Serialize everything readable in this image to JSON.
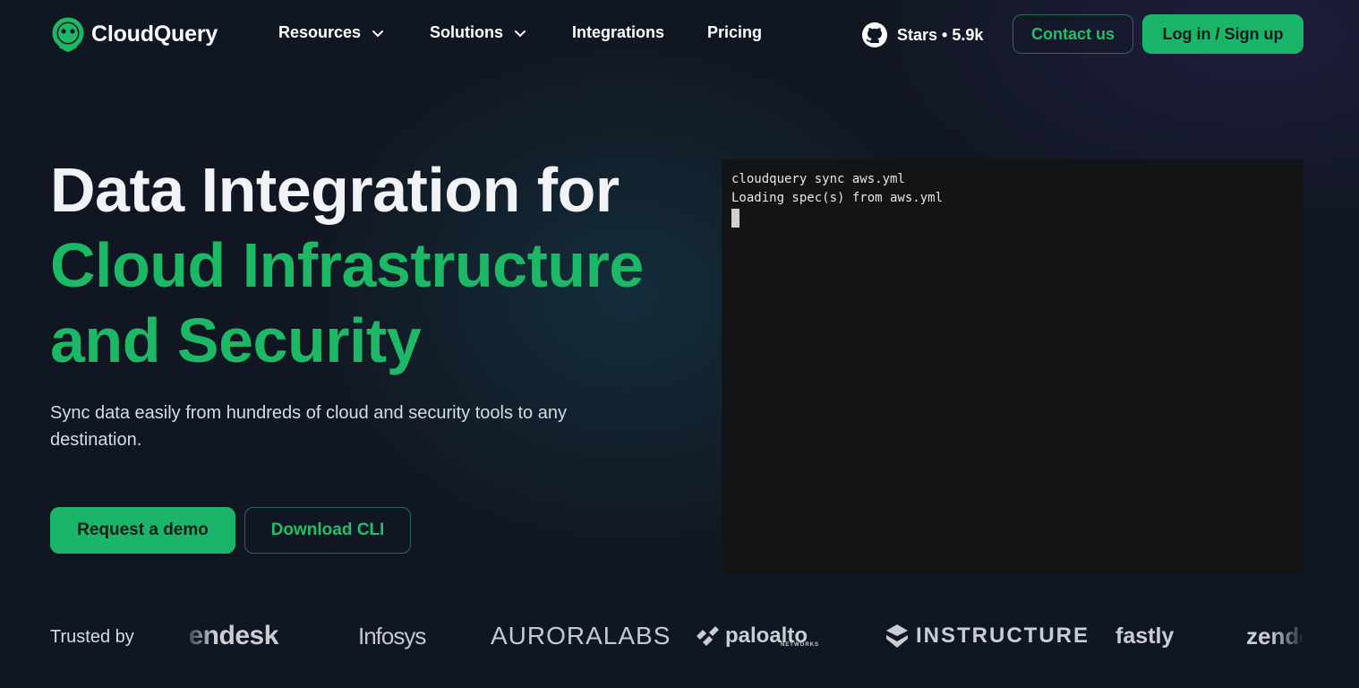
{
  "brand": {
    "name": "CloudQuery",
    "accent": "#1db866"
  },
  "nav": {
    "items": [
      {
        "label": "Resources",
        "has_dropdown": true
      },
      {
        "label": "Solutions",
        "has_dropdown": true
      },
      {
        "label": "Integrations",
        "has_dropdown": false
      },
      {
        "label": "Pricing",
        "has_dropdown": false
      }
    ],
    "stars": "Stars • 5.9k",
    "contact_label": "Contact us",
    "login_label": "Log in / Sign up"
  },
  "hero": {
    "title_line1": "Data Integration for",
    "title_line2": "Cloud Infrastructure",
    "title_line3": "and Security",
    "subtitle": "Sync data easily from hundreds of cloud and security tools to any destination.",
    "primary_cta": "Request a demo",
    "secondary_cta": "Download CLI"
  },
  "terminal": {
    "lines": [
      "cloudquery sync aws.yml",
      "Loading spec(s) from aws.yml"
    ]
  },
  "trusted": {
    "label": "Trusted by",
    "logos": {
      "zendesk": "zendesk",
      "infosys": "Infosys",
      "aurora": "AURORALABS",
      "paloalto": "paloalto",
      "paloalto_sub": "NETWORKS",
      "instructure": "INSTRUCTURE",
      "fastly": "fastly",
      "zen2": "zendesk"
    }
  }
}
